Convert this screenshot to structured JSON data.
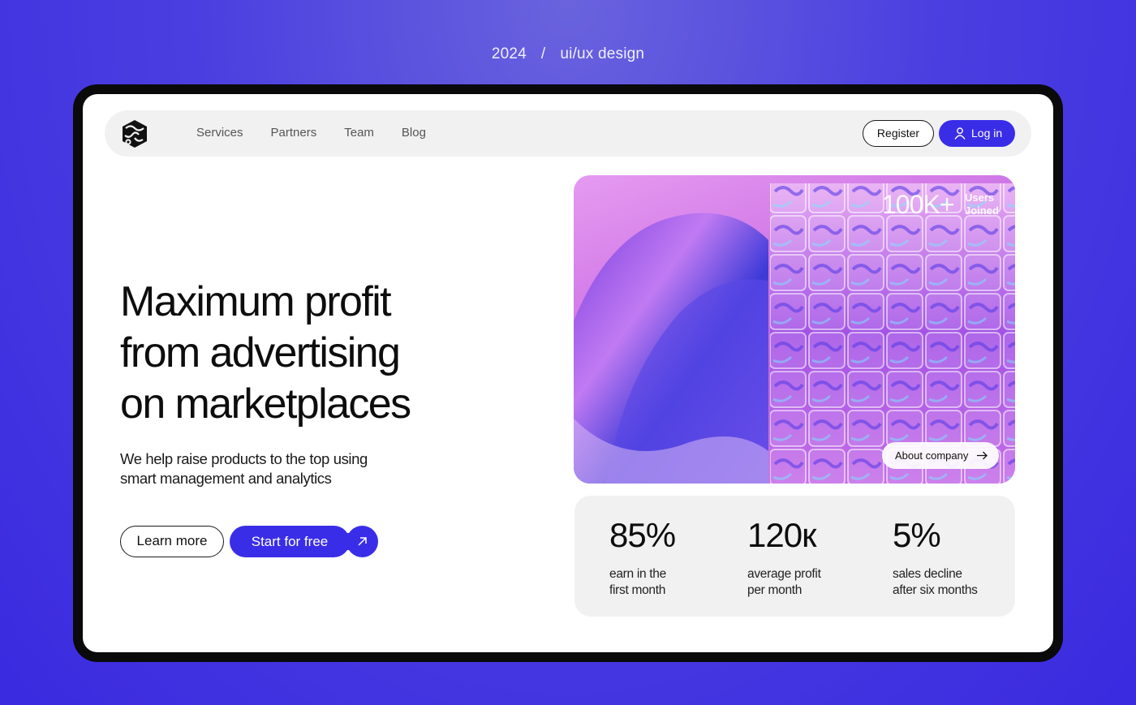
{
  "caption": {
    "year": "2024",
    "separator": "/",
    "category": "ui/ux design"
  },
  "nav": {
    "links": [
      "Services",
      "Partners",
      "Team",
      "Blog"
    ],
    "register_label": "Register",
    "login_label": "Log in"
  },
  "hero": {
    "headline_lines": [
      "Maximum profit",
      "from advertising",
      "on marketplaces"
    ],
    "subtext_lines": [
      "We help raise products to the top using",
      "smart management and analytics"
    ],
    "learn_more_label": "Learn more",
    "start_label": "Start for free"
  },
  "card": {
    "users_count": "100K+",
    "users_label_lines": [
      "Users",
      "Joined"
    ],
    "about_label": "About company"
  },
  "stats": [
    {
      "value": "85%",
      "label_lines": [
        "earn in the",
        "first month"
      ]
    },
    {
      "value": "120к",
      "label_lines": [
        "average profit",
        "per month"
      ]
    },
    {
      "value": "5%",
      "label_lines": [
        "sales decline",
        "after six months"
      ]
    }
  ],
  "colors": {
    "accent": "#3a2de8",
    "background": "#4b3fe0",
    "panel": "#f1f1f2"
  },
  "icons": [
    "logo-icon",
    "user-icon",
    "arrow-up-right-icon",
    "arrow-right-icon"
  ]
}
